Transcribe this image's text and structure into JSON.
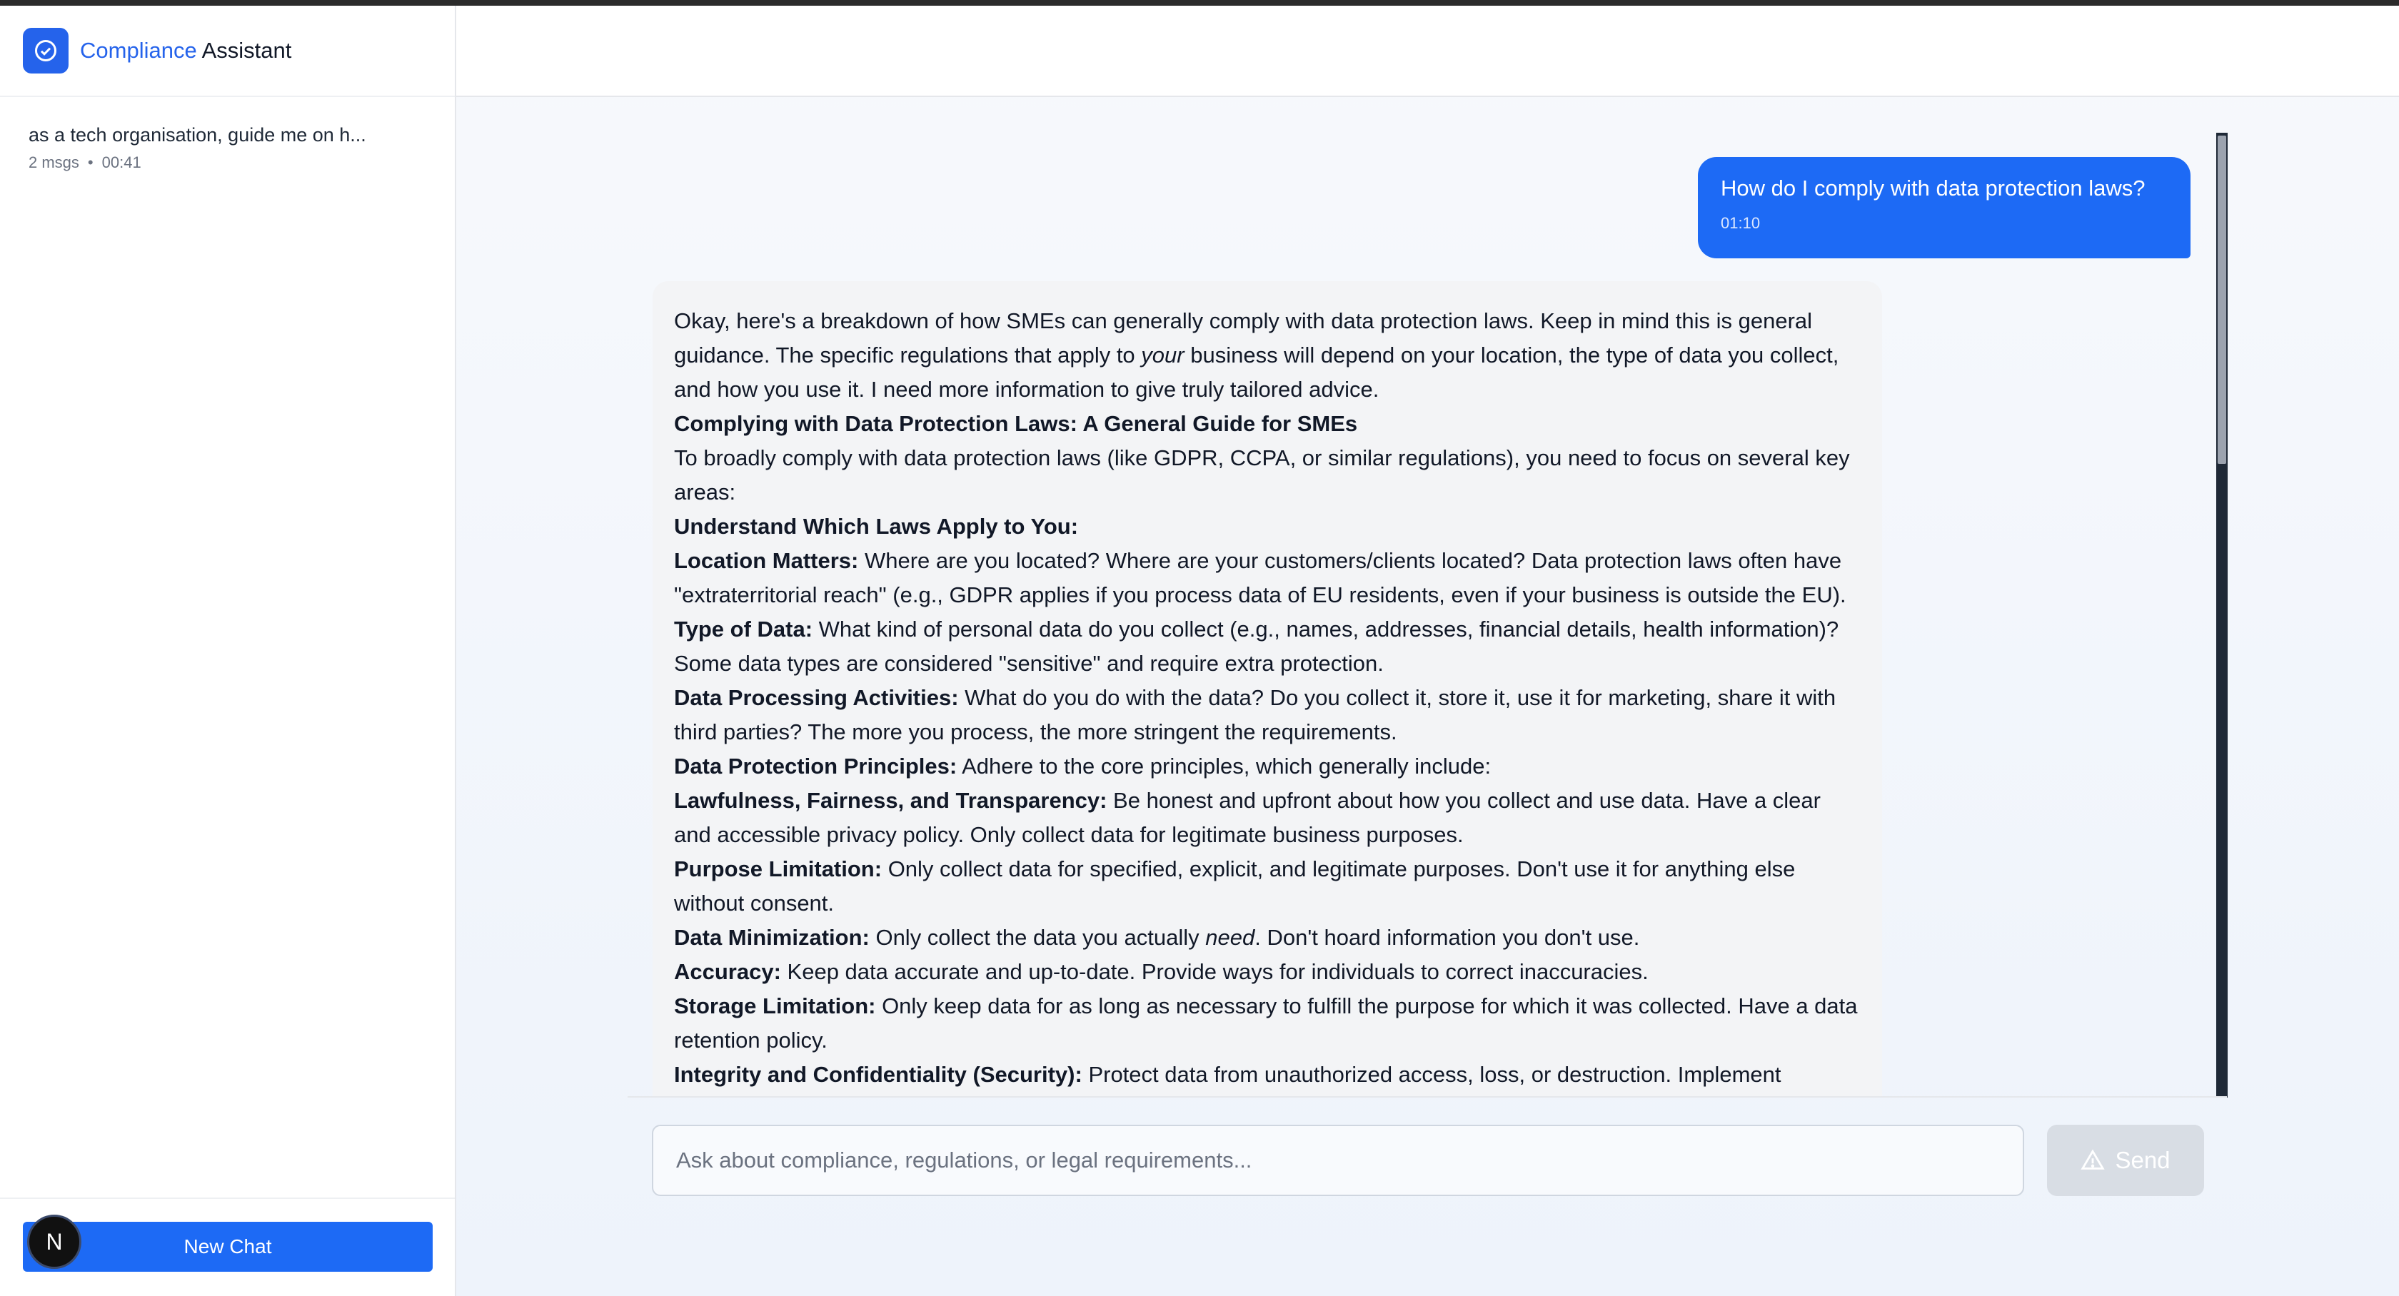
{
  "app": {
    "brand_accent": "Compliance",
    "brand_rest": " Assistant",
    "brand_icon": "check-circle-icon",
    "accent_color": "#2563eb"
  },
  "sidebar": {
    "conversations": [
      {
        "title": "as a tech organisation, guide me on h...",
        "count": "2 msgs",
        "time": "00:41"
      }
    ],
    "new_chat_label": "New Chat",
    "avatar_letter": "N"
  },
  "chat": {
    "user_message": {
      "text": "How do I comply with data protection laws?",
      "time": "01:10"
    },
    "assistant_message": {
      "intro_parts": [
        "Okay, here's a breakdown of how SMEs can generally comply with data protection laws. Keep in mind this is general guidance. The specific regulations that apply to ",
        "your",
        " business will depend on your location, the type of data you collect, and how you use it. I need more information to give truly tailored advice."
      ],
      "heading": "Complying with Data Protection Laws: A General Guide for SMEs",
      "lead": "To broadly comply with data protection laws (like GDPR, CCPA, or similar regulations), you need to focus on several key areas:",
      "section_title": "Understand Which Laws Apply to You:",
      "items": [
        {
          "label": "Location Matters:",
          "text": " Where are you located? Where are your customers/clients located? Data protection laws often have \"extraterritorial reach\" (e.g., GDPR applies if you process data of EU residents, even if your business is outside the EU)."
        },
        {
          "label": "Type of Data:",
          "text": " What kind of personal data do you collect (e.g., names, addresses, financial details, health information)? Some data types are considered \"sensitive\" and require extra protection."
        },
        {
          "label": "Data Processing Activities:",
          "text": " What do you do with the data? Do you collect it, store it, use it for marketing, share it with third parties? The more you process, the more stringent the requirements."
        },
        {
          "label": "Data Protection Principles:",
          "text": " Adhere to the core principles, which generally include:"
        },
        {
          "label": "Lawfulness, Fairness, and Transparency:",
          "text": " Be honest and upfront about how you collect and use data. Have a clear and accessible privacy policy. Only collect data for legitimate business purposes."
        },
        {
          "label": "Purpose Limitation:",
          "text": " Only collect data for specified, explicit, and legitimate purposes. Don't use it for anything else without consent."
        }
      ],
      "minimization": {
        "label": "Data Minimization:",
        "before": " Only collect the data you actually ",
        "em": "need",
        "after": ". Don't hoard information you don't use."
      },
      "items_after": [
        {
          "label": "Accuracy:",
          "text": " Keep data accurate and up-to-date. Provide ways for individuals to correct inaccuracies."
        },
        {
          "label": "Storage Limitation:",
          "text": " Only keep data for as long as necessary to fulfill the purpose for which it was collected. Have a data retention policy."
        },
        {
          "label": "Integrity and Confidentiality (Security):",
          "text": " Protect data from unauthorized access, loss, or destruction. Implement"
        }
      ]
    }
  },
  "composer": {
    "placeholder": "Ask about compliance, regulations, or legal requirements...",
    "send_label": "Send",
    "send_icon": "warning-triangle-icon"
  }
}
